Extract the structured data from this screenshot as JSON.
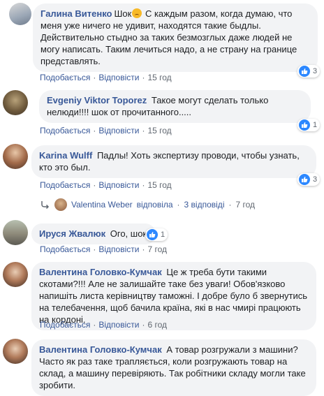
{
  "comments": [
    {
      "author": "Галина Витенко",
      "text_before_emoji": "Шок",
      "has_emoji": true,
      "text": "С каждым разом, когда думаю, что меня уже ничего не удивит, находятся такие быдлы. Действительно стыдно за таких безмозглых даже людей не могу написать. Таким лечиться надо, а не страну на границе представлять.",
      "like": "Подобається",
      "reply": "Відповісти",
      "time": "15 год",
      "reaction_count": "3"
    },
    {
      "author": "Evgeniy Viktor Toporez",
      "text": "Такое могут сделать только нелюди!!!! шок от прочитанного.....",
      "like": "Подобається",
      "reply": "Відповісти",
      "time": "15 год",
      "reaction_count": "1"
    },
    {
      "author": "Karina Wulff",
      "text": "Падлы! Хоть экспертизу проводи, чтобы узнать, кто это был.",
      "like": "Подобається",
      "reply": "Відповісти",
      "time": "15 год",
      "reaction_count": "3"
    },
    {
      "author": "Ируся Жвалюк",
      "text": "Ого, шок",
      "like": "Подобається",
      "reply": "Відповісти",
      "time": "7 год",
      "reaction_count": "1"
    },
    {
      "author": "Валентина Головко-Кумчак",
      "text": "Це ж треба бути такими скотами?!!! Але не залишайте таке без уваги! Обов'язково напишіть листа керівництву таможні. І добре було б звернутись на телебачення, щоб бачила країна, які в нас чмирі працюють на кордоні.",
      "like": "Подобається",
      "reply": "Відповісти",
      "time": "6 год"
    },
    {
      "author": "Валентина Головко-Кумчак",
      "text": "А товар розгружали з машини? Часто як раз таке трапляється, коли розгружають товар на склад, а машину перевіряють. Так робітники складу могли таке зробити."
    }
  ],
  "replies_summary": {
    "author": "Valentina Weber",
    "verb": "відповіла",
    "count_text": "3 відповіді",
    "time": "7 год"
  },
  "colors": {
    "link": "#385898",
    "bubble": "#f2f3f5",
    "meta": "#606770",
    "like_blue": "#2d88ff"
  }
}
